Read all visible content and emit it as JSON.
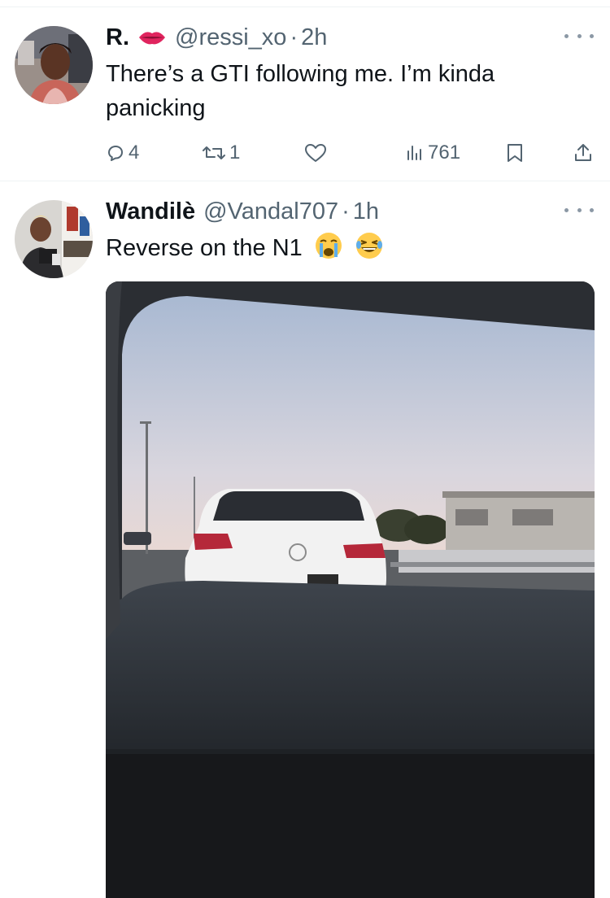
{
  "tweets": [
    {
      "name": "R.",
      "handle": "@ressi_xo",
      "separator": "·",
      "time": "2h",
      "text": "There’s a GTI following me. I’m kinda panicking",
      "stats": {
        "replies": "4",
        "retweets": "1",
        "views": "761"
      }
    },
    {
      "name": "Wandilè",
      "handle": "@Vandal707",
      "separator": "·",
      "time": "1h",
      "text": "Reverse on the N1"
    }
  ],
  "colors": {
    "text_primary": "#0f1419",
    "text_secondary": "#536471",
    "divider": "#eff3f4"
  },
  "icons": [
    "lips-emoji",
    "reply-icon",
    "retweet-icon",
    "like-icon",
    "views-icon",
    "bookmark-icon",
    "share-icon",
    "more-icon",
    "crying-emoji",
    "laughing-emoji"
  ]
}
